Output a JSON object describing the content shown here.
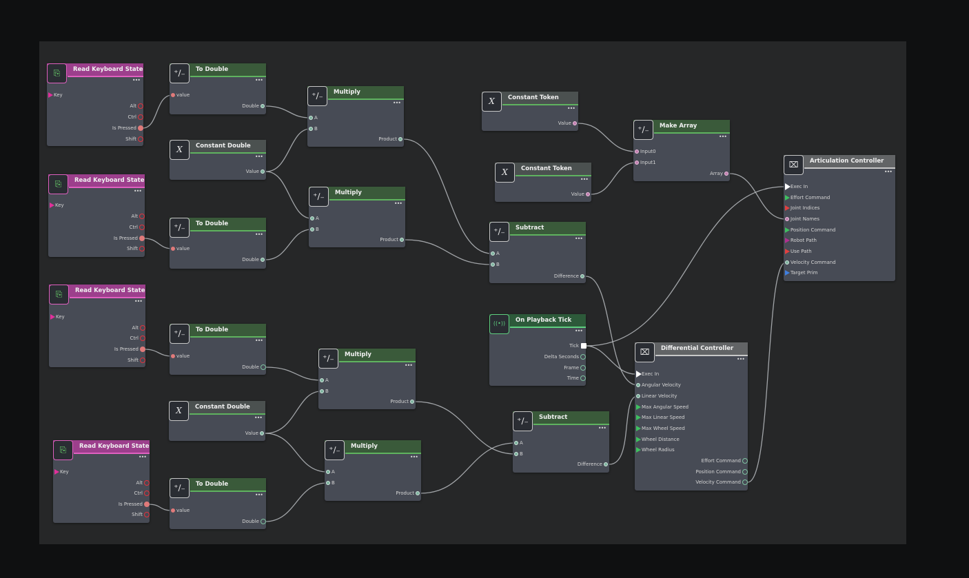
{
  "colors": {
    "background": "#0f1011",
    "canvas": "#262728",
    "node_body": "#474b55",
    "keyboard_accent": "#e060c0",
    "math_accent": "#5fb35f",
    "event_accent": "#5fd07f",
    "wire": "#b8bcc0"
  },
  "nodes": {
    "kb1": {
      "title": "Read Keyboard State",
      "key": "Key",
      "alt": "Alt",
      "ctrl": "Ctrl",
      "pressed": "Is Pressed",
      "shift": "Shift",
      "icon": "keyboard-icon"
    },
    "kb2": {
      "title": "Read Keyboard State",
      "key": "Key",
      "alt": "Alt",
      "ctrl": "Ctrl",
      "pressed": "Is Pressed",
      "shift": "Shift",
      "icon": "keyboard-icon"
    },
    "kb3": {
      "title": "Read Keyboard State",
      "key": "Key",
      "alt": "Alt",
      "ctrl": "Ctrl",
      "pressed": "Is Pressed",
      "shift": "Shift",
      "icon": "keyboard-icon"
    },
    "kb4": {
      "title": "Read Keyboard State",
      "key": "Key",
      "alt": "Alt",
      "ctrl": "Ctrl",
      "pressed": "Is Pressed",
      "shift": "Shift",
      "icon": "keyboard-icon"
    },
    "td1": {
      "title": "To Double",
      "in": "value",
      "out": "Double"
    },
    "td2": {
      "title": "To Double",
      "in": "value",
      "out": "Double"
    },
    "td3": {
      "title": "To Double",
      "in": "value",
      "out": "Double"
    },
    "td4": {
      "title": "To Double",
      "in": "value",
      "out": "Double"
    },
    "cd1": {
      "title": "Constant Double",
      "out": "Value"
    },
    "cd2": {
      "title": "Constant Double",
      "out": "Value"
    },
    "mul1": {
      "title": "Multiply",
      "a": "A",
      "b": "B",
      "out": "Product"
    },
    "mul2": {
      "title": "Multiply",
      "a": "A",
      "b": "B",
      "out": "Product"
    },
    "mul3": {
      "title": "Multiply",
      "a": "A",
      "b": "B",
      "out": "Product"
    },
    "mul4": {
      "title": "Multiply",
      "a": "A",
      "b": "B",
      "out": "Product"
    },
    "ct1": {
      "title": "Constant Token",
      "out": "Value"
    },
    "ct2": {
      "title": "Constant Token",
      "out": "Value"
    },
    "arr": {
      "title": "Make Array",
      "in0": "Input0",
      "in1": "Input1",
      "out": "Array"
    },
    "sub1": {
      "title": "Subtract",
      "a": "A",
      "b": "B",
      "out": "Difference"
    },
    "sub2": {
      "title": "Subtract",
      "a": "A",
      "b": "B",
      "out": "Difference"
    },
    "tick": {
      "title": "On Playback Tick",
      "tick": "Tick",
      "delta": "Delta Seconds",
      "frame": "Frame",
      "time": "Time"
    },
    "diff": {
      "title": "Differential Controller",
      "inputs": [
        "Exec In",
        "Angular Velocity",
        "Linear Velocity",
        "Max Angular Speed",
        "Max Linear Speed",
        "Max Wheel Speed",
        "Wheel Distance",
        "Wheel Radius"
      ],
      "outputs": [
        "Effort Command",
        "Position Command",
        "Velocity Command"
      ]
    },
    "art": {
      "title": "Articulation Controller",
      "inputs": [
        "Exec In",
        "Effort Command",
        "Joint Indices",
        "Joint Names",
        "Position Command",
        "Robot Path",
        "Use Path",
        "Velocity Command",
        "Target Prim"
      ]
    }
  },
  "icons": {
    "math": "plus-minus-icon",
    "const": "x-variable-icon",
    "event": "signal-icon",
    "ctrl": "controller-icon"
  },
  "symbols": {
    "math": "⁺∕₋",
    "const": "X",
    "keyboard": "⎘",
    "event": "((•))",
    "ctrl": "⌧"
  }
}
